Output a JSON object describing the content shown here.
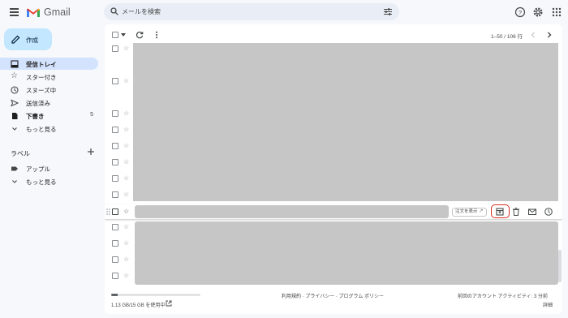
{
  "app": {
    "name": "Gmail"
  },
  "search": {
    "placeholder": "メールを検索"
  },
  "sidebar": {
    "compose_label": "作成",
    "items": [
      {
        "label": "受信トレイ",
        "icon": "inbox-icon",
        "active": true,
        "count": ""
      },
      {
        "label": "スター付き",
        "icon": "star-icon",
        "active": false,
        "count": ""
      },
      {
        "label": "スヌーズ中",
        "icon": "clock-icon",
        "active": false,
        "count": ""
      },
      {
        "label": "送信済み",
        "icon": "send-icon",
        "active": false,
        "count": ""
      },
      {
        "label": "下書き",
        "icon": "draft-icon",
        "active": false,
        "count": "5"
      },
      {
        "label": "もっと見る",
        "icon": "chevron-down-icon",
        "active": false,
        "count": ""
      }
    ],
    "labels_title": "ラベル",
    "label_items": [
      {
        "label": "アップル",
        "icon": "label-icon"
      },
      {
        "label": "もっと見る",
        "icon": "chevron-down-icon"
      }
    ]
  },
  "toolbar": {
    "pager": "1–50 / 106 行"
  },
  "hover_row": {
    "chip_label": "注文を表示 ↗",
    "actions": [
      "archive-icon",
      "trash-icon",
      "mark-unread-icon",
      "snooze-icon"
    ]
  },
  "footer": {
    "storage_text": "1.13 GB/15 GB を使用中",
    "storage_fraction": 0.075,
    "links": "利用規約 · プライバシー · プログラム ポリシー",
    "activity": "前回のアカウント アクティビティ: 3 分前",
    "details": "詳細"
  },
  "colors": {
    "accent": "#c2e7ff",
    "active_nav": "#d3e3fd",
    "highlight": "#d93025"
  }
}
